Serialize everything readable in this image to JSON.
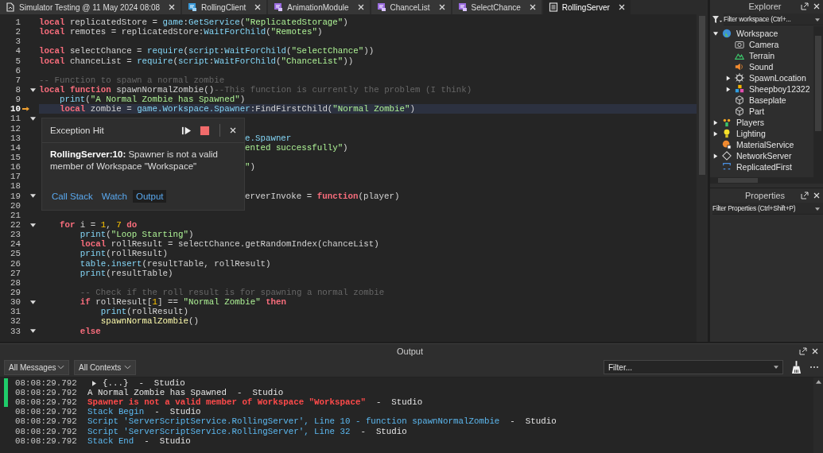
{
  "tabs": [
    {
      "label": "Simulator Testing @ 11 May 2024 08:08",
      "kind": "place",
      "selected": false
    },
    {
      "label": "RollingClient",
      "kind": "localscript",
      "selected": false
    },
    {
      "label": "AnimationModule",
      "kind": "module",
      "selected": false
    },
    {
      "label": "ChanceList",
      "kind": "module",
      "selected": false
    },
    {
      "label": "SelectChance",
      "kind": "module",
      "selected": false
    },
    {
      "label": "RollingServer",
      "kind": "script",
      "selected": true
    }
  ],
  "editor": {
    "lines": [
      {
        "n": "1",
        "kind": "code",
        "fold": false,
        "current": false,
        "tokens": [
          {
            "kind": "keyword",
            "text": "local"
          },
          {
            "kind": "plain",
            "text": " replicatedStore = "
          },
          {
            "kind": "builtin",
            "text": "game"
          },
          {
            "kind": "plain",
            "text": ":"
          },
          {
            "kind": "builtin",
            "text": "GetService"
          },
          {
            "kind": "plain",
            "text": "("
          },
          {
            "kind": "string",
            "text": "\"ReplicatedStorage\""
          },
          {
            "kind": "plain",
            "text": ")"
          }
        ]
      },
      {
        "n": "2",
        "kind": "code",
        "fold": false,
        "current": false,
        "tokens": [
          {
            "kind": "keyword",
            "text": "local"
          },
          {
            "kind": "plain",
            "text": " remotes = replicatedStore:"
          },
          {
            "kind": "builtin",
            "text": "WaitForChild"
          },
          {
            "kind": "plain",
            "text": "("
          },
          {
            "kind": "string",
            "text": "\"Remotes\""
          },
          {
            "kind": "plain",
            "text": ")"
          }
        ]
      },
      {
        "n": "3",
        "fold": false,
        "current": false
      },
      {
        "n": "4",
        "kind": "code",
        "fold": false,
        "current": false,
        "tokens": [
          {
            "kind": "keyword",
            "text": "local"
          },
          {
            "kind": "plain",
            "text": " selectChance = "
          },
          {
            "kind": "builtin",
            "text": "require"
          },
          {
            "kind": "plain",
            "text": "("
          },
          {
            "kind": "builtin",
            "text": "script"
          },
          {
            "kind": "plain",
            "text": ":"
          },
          {
            "kind": "builtin",
            "text": "WaitForChild"
          },
          {
            "kind": "plain",
            "text": "("
          },
          {
            "kind": "string",
            "text": "\"SelectChance\""
          },
          {
            "kind": "plain",
            "text": "))"
          }
        ]
      },
      {
        "n": "5",
        "kind": "code",
        "fold": false,
        "current": false,
        "tokens": [
          {
            "kind": "keyword",
            "text": "local"
          },
          {
            "kind": "plain",
            "text": " chanceList = "
          },
          {
            "kind": "builtin",
            "text": "require"
          },
          {
            "kind": "plain",
            "text": "("
          },
          {
            "kind": "builtin",
            "text": "script"
          },
          {
            "kind": "plain",
            "text": ":"
          },
          {
            "kind": "builtin",
            "text": "WaitForChild"
          },
          {
            "kind": "plain",
            "text": "("
          },
          {
            "kind": "string",
            "text": "\"ChanceList\""
          },
          {
            "kind": "plain",
            "text": "))"
          }
        ]
      },
      {
        "n": "6",
        "fold": false,
        "current": false
      },
      {
        "n": "7",
        "kind": "code",
        "fold": false,
        "current": false,
        "tokens": [
          {
            "kind": "comment",
            "text": "-- Function to spawn a normal zombie"
          }
        ]
      },
      {
        "n": "8",
        "kind": "code",
        "fold": true,
        "current": false,
        "tokens": [
          {
            "kind": "keyword",
            "text": "local function"
          },
          {
            "kind": "plain",
            "text": " spawnNormalZombie()"
          },
          {
            "kind": "comment",
            "text": "--This function is currently the problem (I think)"
          }
        ]
      },
      {
        "n": "9",
        "kind": "code",
        "fold": false,
        "current": false,
        "tokens": [
          {
            "kind": "builtin",
            "text": "    print"
          },
          {
            "kind": "plain",
            "text": "("
          },
          {
            "kind": "string",
            "text": "\"A Normal Zombie has Spawned\""
          },
          {
            "kind": "plain",
            "text": ")"
          }
        ]
      },
      {
        "n": "10",
        "kind": "code",
        "fold": false,
        "current": true,
        "tokens": [
          {
            "kind": "keyword",
            "text": "    local"
          },
          {
            "kind": "plain",
            "text": " zombie = "
          },
          {
            "kind": "builtin",
            "text": "game.Workspace.Spawner"
          },
          {
            "kind": "plain",
            "text": ":FindFirstChild("
          },
          {
            "kind": "string",
            "text": "\"Normal Zombie\""
          },
          {
            "kind": "plain",
            "text": ")"
          }
        ]
      },
      {
        "n": "11",
        "fold": true,
        "current": false
      },
      {
        "n": "12",
        "fold": false,
        "current": false
      },
      {
        "n": "13",
        "kind": "partial",
        "fold": false,
        "current": false,
        "tokens": [
          {
            "kind": "builtin",
            "text": "e.Spawner"
          }
        ]
      },
      {
        "n": "14",
        "kind": "partial",
        "fold": false,
        "current": false,
        "tokens": [
          {
            "kind": "string",
            "text": "ented successfully\""
          },
          {
            "kind": "plain",
            "text": ")"
          }
        ]
      },
      {
        "n": "15",
        "fold": false,
        "current": false
      },
      {
        "n": "16",
        "kind": "partial",
        "fold": false,
        "current": false,
        "tokens": [
          {
            "kind": "string",
            "text": "\""
          },
          {
            "kind": "plain",
            "text": ")"
          }
        ]
      },
      {
        "n": "17",
        "fold": false,
        "current": false
      },
      {
        "n": "18",
        "fold": false,
        "current": false
      },
      {
        "n": "19",
        "kind": "partial",
        "fold": true,
        "current": false,
        "tokens": [
          {
            "kind": "plain",
            "text": "erverInvoke = "
          },
          {
            "kind": "keyword",
            "text": "function"
          },
          {
            "kind": "plain",
            "text": "(player)"
          }
        ]
      },
      {
        "n": "20",
        "fold": false,
        "current": false
      },
      {
        "n": "21",
        "fold": false,
        "current": false
      },
      {
        "n": "22",
        "kind": "code",
        "fold": true,
        "current": false,
        "tokens": [
          {
            "kind": "keyword",
            "text": "    for"
          },
          {
            "kind": "plain",
            "text": " i = "
          },
          {
            "kind": "number",
            "text": "1"
          },
          {
            "kind": "plain",
            "text": ", "
          },
          {
            "kind": "number",
            "text": "7"
          },
          {
            "kind": "keyword",
            "text": " do"
          }
        ]
      },
      {
        "n": "23",
        "kind": "code",
        "fold": false,
        "current": false,
        "tokens": [
          {
            "kind": "builtin",
            "text": "        print"
          },
          {
            "kind": "plain",
            "text": "("
          },
          {
            "kind": "string",
            "text": "\"Loop Starting\""
          },
          {
            "kind": "plain",
            "text": ")"
          }
        ]
      },
      {
        "n": "24",
        "kind": "code",
        "fold": false,
        "current": false,
        "tokens": [
          {
            "kind": "keyword",
            "text": "        local"
          },
          {
            "kind": "plain",
            "text": " rollResult = selectChance.getRandomIndex(chanceList)"
          }
        ]
      },
      {
        "n": "25",
        "kind": "code",
        "fold": false,
        "current": false,
        "tokens": [
          {
            "kind": "builtin",
            "text": "        print"
          },
          {
            "kind": "plain",
            "text": "(rollResult)"
          }
        ]
      },
      {
        "n": "26",
        "kind": "code",
        "fold": false,
        "current": false,
        "tokens": [
          {
            "kind": "builtin",
            "text": "        table.insert"
          },
          {
            "kind": "plain",
            "text": "(resultTable, rollResult)"
          }
        ]
      },
      {
        "n": "27",
        "kind": "code",
        "fold": false,
        "current": false,
        "tokens": [
          {
            "kind": "builtin",
            "text": "        print"
          },
          {
            "kind": "plain",
            "text": "(resultTable)"
          }
        ]
      },
      {
        "n": "28",
        "fold": false,
        "current": false
      },
      {
        "n": "29",
        "kind": "code",
        "fold": false,
        "current": false,
        "tokens": [
          {
            "kind": "comment",
            "text": "        -- Check if the roll result is for spawning a normal zombie"
          }
        ]
      },
      {
        "n": "30",
        "kind": "code",
        "fold": true,
        "current": false,
        "tokens": [
          {
            "kind": "keyword",
            "text": "        if"
          },
          {
            "kind": "plain",
            "text": " rollResult["
          },
          {
            "kind": "number",
            "text": "1"
          },
          {
            "kind": "plain",
            "text": "] == "
          },
          {
            "kind": "string",
            "text": "\"Normal Zombie\""
          },
          {
            "kind": "keyword",
            "text": " then"
          }
        ]
      },
      {
        "n": "31",
        "kind": "code",
        "fold": false,
        "current": false,
        "tokens": [
          {
            "kind": "builtin",
            "text": "            print"
          },
          {
            "kind": "plain",
            "text": "(rollResult)"
          }
        ]
      },
      {
        "n": "32",
        "kind": "code",
        "fold": false,
        "current": false,
        "tokens": [
          {
            "kind": "function",
            "text": "            spawnNormalZombie"
          },
          {
            "kind": "plain",
            "text": "()"
          }
        ]
      },
      {
        "n": "33",
        "kind": "code",
        "fold": true,
        "current": false,
        "tokens": [
          {
            "kind": "keyword",
            "text": "        else"
          }
        ]
      }
    ]
  },
  "exception_popup": {
    "title": "Exception Hit",
    "message": "**RollingServer:10:** Spawner is not a valid member of Workspace \"Workspace\"",
    "links": [
      {
        "label": "Call Stack",
        "selected": false
      },
      {
        "label": "Watch",
        "selected": false
      },
      {
        "label": "Output",
        "selected": true
      }
    ]
  },
  "explorer": {
    "title": "Explorer",
    "filter": {
      "placeholder": "Filter workspace (Ctrl+..."
    },
    "items": [
      {
        "label": "Workspace",
        "kind": "workspace",
        "expanded": true,
        "children": [
          {
            "label": "Camera",
            "kind": "camera"
          },
          {
            "label": "Terrain",
            "kind": "terrain"
          },
          {
            "label": "Sound",
            "kind": "sound"
          },
          {
            "label": "SpawnLocation",
            "kind": "spawn",
            "expanded": false
          },
          {
            "label": "Sheepboy12322",
            "kind": "model",
            "expanded": false
          },
          {
            "label": "Baseplate",
            "kind": "part"
          },
          {
            "label": "Part",
            "kind": "part"
          }
        ]
      },
      {
        "label": "Players",
        "kind": "players",
        "expanded": false
      },
      {
        "label": "Lighting",
        "kind": "lighting",
        "expanded": false
      },
      {
        "label": "MaterialService",
        "kind": "material"
      },
      {
        "label": "NetworkServer",
        "kind": "network",
        "expanded": false
      },
      {
        "label": "ReplicatedFirst",
        "kind": "replicated"
      }
    ]
  },
  "properties": {
    "title": "Properties",
    "filter": {
      "placeholder": "Filter Properties (Ctrl+Shift+P)"
    }
  },
  "output": {
    "title": "Output",
    "message_filter": "All Messages",
    "context_filter": "All Contexts",
    "filter": {
      "placeholder": "Filter..."
    },
    "messages": [
      {
        "time": "08:08:29.792",
        "kind": "table",
        "text": "{...}",
        "source": "-  Studio",
        "marked": true
      },
      {
        "time": "08:08:29.792",
        "kind": "plain",
        "text": "A Normal Zombie has Spawned",
        "source": "-  Studio",
        "marked": true
      },
      {
        "time": "08:08:29.792",
        "kind": "error",
        "text": "Spawner is not a valid member of Workspace \"Workspace\"",
        "source": "-  Studio",
        "marked": true
      },
      {
        "time": "08:08:29.792",
        "kind": "info",
        "text": "Stack Begin",
        "source": "-  Studio",
        "marked": false
      },
      {
        "time": "08:08:29.792",
        "kind": "info",
        "text": "Script 'ServerScriptService.RollingServer', Line 10 - function spawnNormalZombie",
        "source": "-  Studio",
        "marked": false
      },
      {
        "time": "08:08:29.792",
        "kind": "info",
        "text": "Script 'ServerScriptService.RollingServer', Line 32",
        "source": "-  Studio",
        "marked": false
      },
      {
        "time": "08:08:29.792",
        "kind": "info",
        "text": "Stack End",
        "source": "-  Studio",
        "marked": false
      }
    ]
  }
}
